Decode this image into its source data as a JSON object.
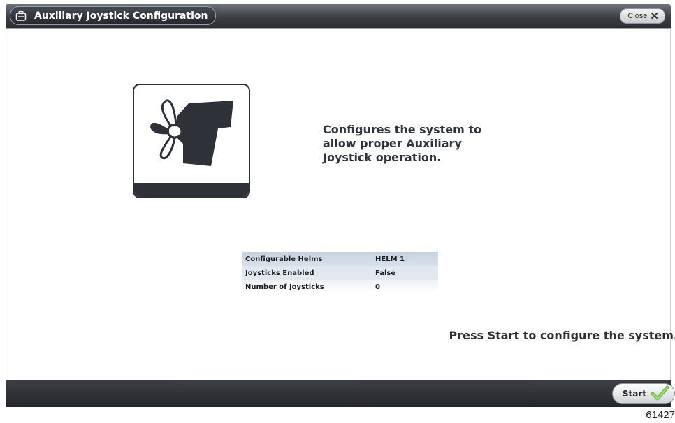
{
  "window": {
    "title": "Auxiliary Joystick Configuration",
    "title_icon": "helm-icon",
    "close_label": "Close"
  },
  "main": {
    "illustration_icon": "propeller-outdrive-icon",
    "description": "Configures the system to\nallow proper Auxiliary\nJoystick operation.",
    "settings": [
      {
        "label": "Configurable Helms",
        "value": "HELM 1"
      },
      {
        "label": "Joysticks Enabled",
        "value": "False"
      },
      {
        "label": "Number of Joysticks",
        "value": "0"
      }
    ],
    "prompt": "Press Start to configure the system."
  },
  "footer": {
    "start_label": "Start",
    "start_icon": "checkmark-icon"
  },
  "figure_number": "61427",
  "colors": {
    "titlebar": "#3b3f45",
    "footer": "#2b2e33",
    "table_header": "#c7d2df",
    "checkmark": "#6cc04a"
  }
}
